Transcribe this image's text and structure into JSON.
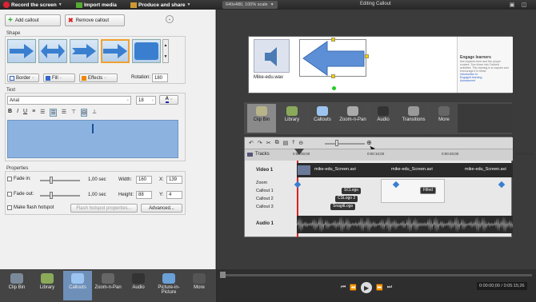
{
  "menu": {
    "record": "Record the screen",
    "import": "Import media",
    "produce": "Produce and share"
  },
  "preview": {
    "scale": "640x480, 100% scale",
    "title": "Editing Callout"
  },
  "callout": {
    "add": "Add callout",
    "remove": "Remove callout"
  },
  "shape": {
    "label": "Shape",
    "border": "Border",
    "fill": "Fill",
    "effects": "Effects",
    "rotation_label": "Rotation:",
    "rotation": "180"
  },
  "text": {
    "label": "Text",
    "font": "Arial",
    "size": "18"
  },
  "properties": {
    "label": "Properties",
    "fade_in": "Fade in:",
    "fade_in_val": "1,00 sec",
    "fade_out": "Fade out:",
    "fade_out_val": "1,00 sec",
    "width_label": "Width:",
    "width": "160",
    "height_label": "Height:",
    "height": "88",
    "x_label": "X:",
    "x": "139",
    "y_label": "Y:",
    "y": "4",
    "flash": "Make flash hotspot",
    "flash_props": "Flash hotspot properties...",
    "advanced": "Advanced..."
  },
  "canvas": {
    "media_label": "Mike-edu.wav",
    "side_title": "Engage learners",
    "side_text": "Not required here and the proper content. Turn them into Toolbelt activities. This training is to explain and encourage it in these.",
    "side_links": [
      "Introduction to",
      "Engaged learning",
      "Assessment"
    ]
  },
  "bin_tabs": [
    "Clip Bin",
    "Library",
    "Callouts",
    "Zoom-n-Pan",
    "Audio",
    "Transitions",
    "More"
  ],
  "bottom_tabs": [
    "Clip Bin",
    "Library",
    "Callouts",
    "Zoom-n-Pan",
    "Audio",
    "Picture-in-Picture",
    "More"
  ],
  "timeline": {
    "tracks_label": "Tracks",
    "ticks": [
      "0:00:00;00",
      "0:00:10;00",
      "0:00:20;00",
      "0:00:30;00"
    ],
    "video_label": "Video 1",
    "clip": "mike-edu_Screen.avi",
    "zoom": "Zoom",
    "callout1": "Callout 1",
    "callout2": "Callout 2",
    "callout3": "Callout 3",
    "audio_label": "Audio 1",
    "markers": [
      "SCLogo",
      "CSLogo 2",
      "SnagitLogo",
      "Filled"
    ]
  },
  "player": {
    "time": "0:00:00;00 / 0:05:15;26"
  },
  "colors": {
    "accent": "#3a7fcf",
    "selected": "#f0a030"
  }
}
